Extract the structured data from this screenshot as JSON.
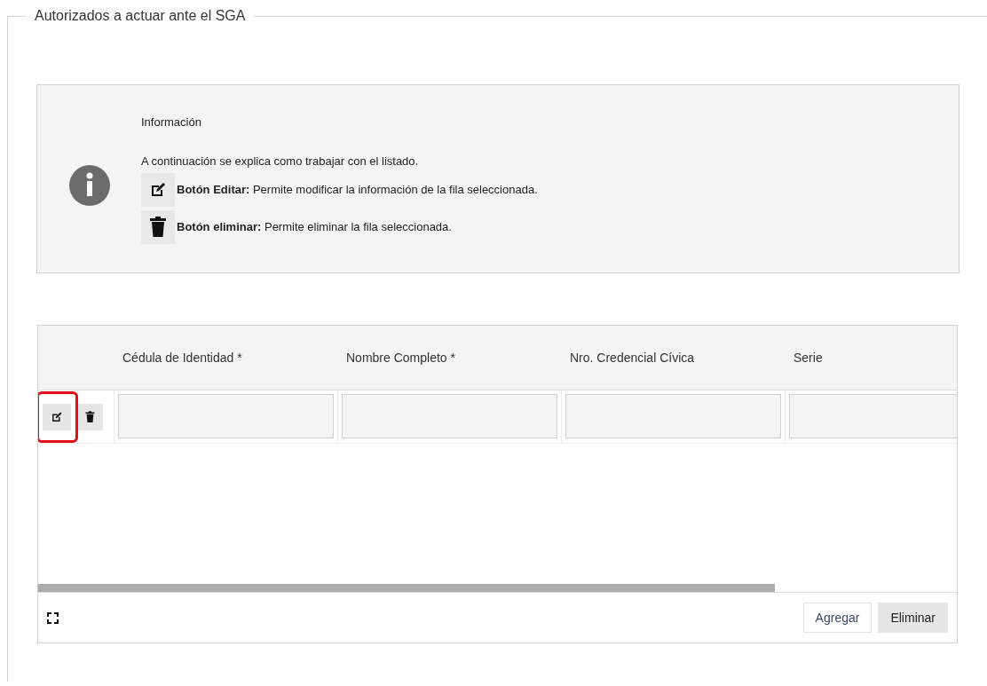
{
  "fieldset": {
    "legend": "Autorizados a actuar ante el SGA"
  },
  "info": {
    "title": "Información",
    "intro": "A continuación se explica como trabajar con el listado.",
    "items": [
      {
        "kind": "edit",
        "text": "**Botón Editar:** Permite modificar la información de la fila seleccionada."
      },
      {
        "kind": "delete",
        "text": "**Botón eliminar:** Permite eliminar la fila seleccionada."
      }
    ]
  },
  "table": {
    "columns": [
      "Cédula de Identidad *",
      "Nombre Completo *",
      "Nro. Credencial Cívica",
      "Serie"
    ],
    "rows": [
      {
        "edit_highlighted": true
      }
    ],
    "footer_buttons": [
      {
        "label": "Agregar",
        "selected": false
      },
      {
        "label": "Eliminar",
        "selected": true
      }
    ]
  }
}
